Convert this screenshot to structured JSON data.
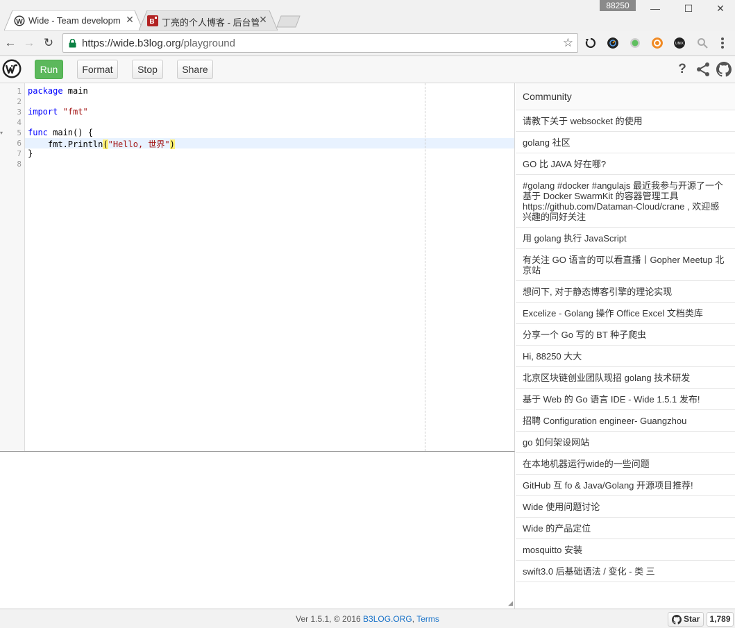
{
  "browser": {
    "tabs": [
      {
        "title": "Wide - Team developm",
        "active": true
      },
      {
        "title": "丁亮的个人博客 - 后台管",
        "active": false
      }
    ],
    "profile_badge": "88250",
    "url_host": "https://wide.b3log.org",
    "url_path": "/playground",
    "extensions": [
      "refresh-extension-icon",
      "speed-dial-icon",
      "green-circle-icon",
      "orange-ring-icon",
      "unix-icon",
      "magnifier-icon"
    ]
  },
  "toolbar": {
    "run_label": "Run",
    "format_label": "Format",
    "stop_label": "Stop",
    "share_label": "Share",
    "help_label": "?"
  },
  "editor": {
    "line_numbers": [
      "1",
      "2",
      "3",
      "4",
      "5",
      "6",
      "7",
      "8"
    ],
    "lines": {
      "l1_kw": "package",
      "l1_rest": " main",
      "l3_kw": "import",
      "l3_str": "\"fmt\"",
      "l5_kw": "func",
      "l5_rest": " main() {",
      "l6_pre": "    fmt.Println",
      "l6_open": "(",
      "l6_str": "\"Hello, 世界\"",
      "l6_close": ")",
      "l7": "}"
    }
  },
  "community": {
    "heading": "Community",
    "posts": [
      "请教下关于 websocket 的使用",
      "golang 社区",
      "GO 比 JAVA 好在哪?",
      "#golang #docker #angulajs 最近我参与开源了一个基于 Docker SwarmKit 的容器管理工具 https://github.com/Dataman-Cloud/crane , 欢迎感兴趣的同好关注",
      "用 golang 执行 JavaScript",
      "有关注 GO 语言的可以看直播丨Gopher Meetup 北京站",
      "想问下, 对于静态博客引擎的理论实现",
      "Excelize - Golang 操作 Office Excel 文档类库",
      "分享一个 Go 写的 BT 种子爬虫",
      "Hi, 88250 大大",
      "北京区块链创业团队现招 golang 技术研发",
      "基于 Web 的 Go 语言 IDE - Wide 1.5.1 发布!",
      "招聘 Configuration engineer- Guangzhou",
      "go 如何架设网站",
      "在本地机器运行wide的一些问题",
      "GitHub 互 fo & Java/Golang 开源项目推荐!",
      "Wide 使用问题讨论",
      "Wide 的产品定位",
      "mosquitto 安装",
      "swift3.0 后基础语法 / 变化 - 类 三"
    ]
  },
  "footer": {
    "version": "Ver 1.5.1, © 2016 ",
    "brand_link": "B3LOG.ORG",
    "separator": ", ",
    "terms_link": "Terms",
    "star_label": "Star",
    "star_count": "1,789"
  },
  "colors": {
    "run_green": "#5cb85c",
    "link_blue": "#1a73c9",
    "keyword_blue": "#0000ff",
    "string_red": "#a31515"
  }
}
